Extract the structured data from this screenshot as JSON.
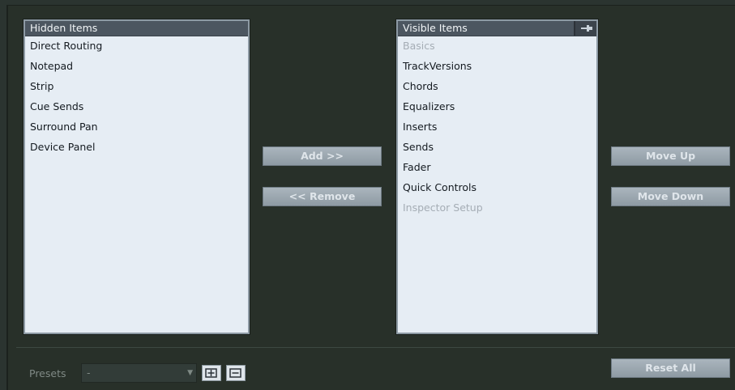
{
  "hidden_list": {
    "header": "Hidden Items",
    "items": [
      "Direct Routing",
      "Notepad",
      "Strip",
      "Cue Sends",
      "Surround Pan",
      "Device Panel"
    ]
  },
  "visible_list": {
    "header": "Visible Items",
    "items": [
      {
        "label": "Basics",
        "dimmed": true
      },
      {
        "label": "TrackVersions",
        "dimmed": false
      },
      {
        "label": "Chords",
        "dimmed": false
      },
      {
        "label": "Equalizers",
        "dimmed": false
      },
      {
        "label": "Inserts",
        "dimmed": false
      },
      {
        "label": "Sends",
        "dimmed": false
      },
      {
        "label": "Fader",
        "dimmed": false
      },
      {
        "label": "Quick Controls",
        "dimmed": false
      },
      {
        "label": "Inspector Setup",
        "dimmed": true
      }
    ]
  },
  "buttons": {
    "add": "Add >>",
    "remove": "<< Remove",
    "move_up": "Move Up",
    "move_down": "Move Down",
    "reset_all": "Reset All"
  },
  "presets": {
    "label": "Presets",
    "selected": "-"
  },
  "icons": {
    "pin": "pin-icon",
    "save_preset": "save-preset-icon",
    "delete_preset": "delete-preset-icon",
    "dropdown": "chevron-down-icon"
  },
  "colors": {
    "background": "#283029",
    "list_bg": "#e6edf4",
    "list_header": "#4c5660",
    "button_bg": "#9aa6ae",
    "button_text": "#dfe5ea"
  }
}
